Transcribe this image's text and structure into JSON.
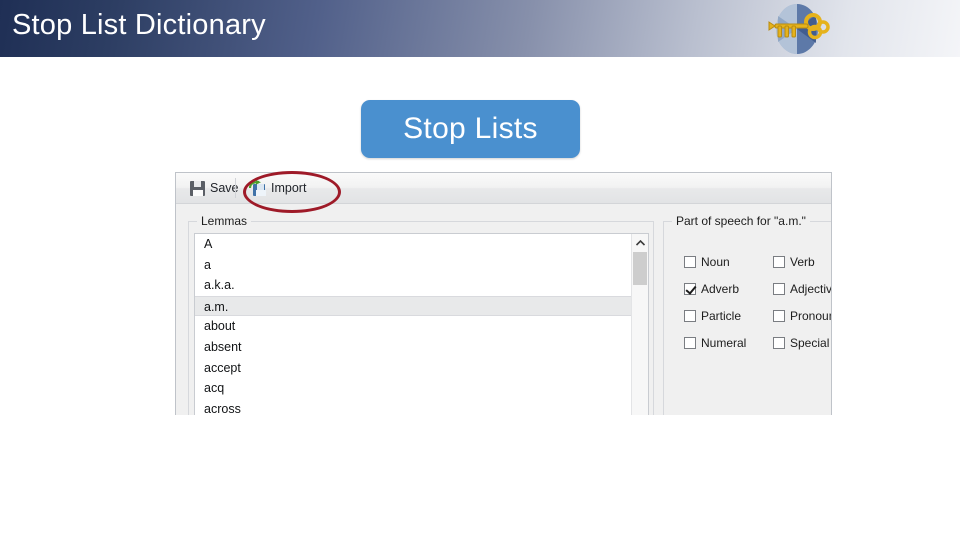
{
  "header": {
    "title": "Stop List Dictionary",
    "logo_icon": "globe-key-logo"
  },
  "badge": {
    "label": "Stop Lists",
    "color": "#4a90cf"
  },
  "dialog": {
    "toolbar": {
      "save_label": "Save",
      "save_icon": "floppy-disk-icon",
      "import_label": "Import",
      "import_icon": "floppy-disk-import-icon"
    },
    "annotation": {
      "shape": "red-ellipse",
      "color": "#9e1a28",
      "target": "Import"
    },
    "lemmas_group": {
      "title": "Lemmas",
      "items": [
        {
          "text": "A",
          "selected": false
        },
        {
          "text": "a",
          "selected": false
        },
        {
          "text": "a.k.a.",
          "selected": false
        },
        {
          "text": "a.m.",
          "selected": true
        },
        {
          "text": "about",
          "selected": false
        },
        {
          "text": "absent",
          "selected": false
        },
        {
          "text": "accept",
          "selected": false
        },
        {
          "text": "acq",
          "selected": false
        },
        {
          "text": "across",
          "selected": false
        }
      ],
      "scrollbar": {
        "up_arrow_icon": "chevron-up-icon"
      }
    },
    "pos_group": {
      "title": "Part of speech for \"a.m.\"",
      "checkboxes": [
        {
          "label": "Noun",
          "checked": false
        },
        {
          "label": "Verb",
          "checked": false
        },
        {
          "label": "Adverb",
          "checked": true
        },
        {
          "label": "Adjective",
          "checked": false
        },
        {
          "label": "Particle",
          "checked": false
        },
        {
          "label": "Pronoun",
          "checked": false
        },
        {
          "label": "Numeral",
          "checked": false
        },
        {
          "label": "Special",
          "checked": false
        }
      ]
    }
  }
}
